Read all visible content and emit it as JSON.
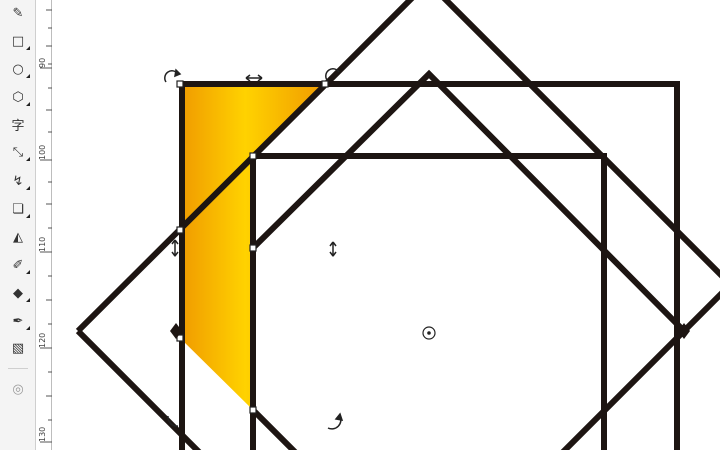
{
  "toolbox": {
    "tools": [
      {
        "icon": "smart-fill-icon",
        "glyph": "✎"
      },
      {
        "icon": "rectangle-icon",
        "glyph": "□"
      },
      {
        "icon": "ellipse-icon",
        "glyph": "○"
      },
      {
        "icon": "polygon-icon",
        "glyph": "⬡"
      },
      {
        "icon": "text-icon",
        "glyph": "字"
      },
      {
        "icon": "dimension-icon",
        "glyph": "⤡"
      },
      {
        "icon": "connector-icon",
        "glyph": "↯"
      },
      {
        "icon": "drop-shadow-icon",
        "glyph": "❏"
      },
      {
        "icon": "transparency-icon",
        "glyph": "◭"
      },
      {
        "icon": "eyedropper-icon",
        "glyph": "✐"
      },
      {
        "icon": "fill-icon",
        "glyph": "◆"
      },
      {
        "icon": "outline-pen-icon",
        "glyph": "✒"
      },
      {
        "icon": "interactive-fill-icon",
        "glyph": "▧"
      }
    ],
    "bottom_icon": {
      "icon": "toolbox-options-icon",
      "glyph": "◎"
    }
  },
  "ruler": {
    "labels": [
      "90",
      "100",
      "110",
      "120",
      "130"
    ]
  },
  "colors": {
    "outline": "#1d1512",
    "fill_light": "#ffd200",
    "fill_dark": "#f09a00",
    "handle": "#222222"
  }
}
